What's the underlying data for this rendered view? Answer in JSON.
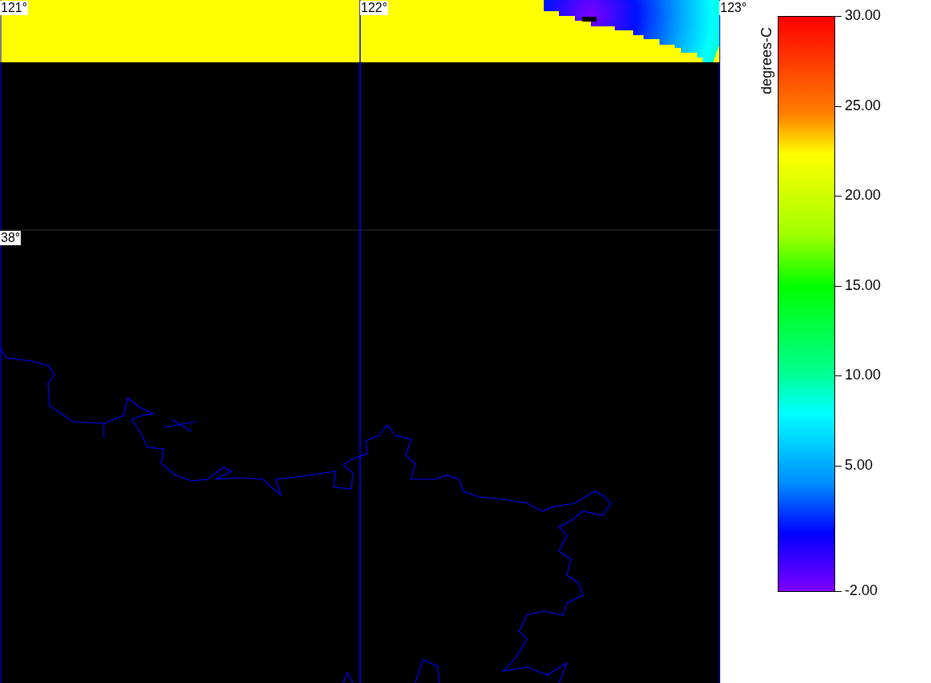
{
  "map": {
    "longitude_labels": [
      "121°",
      "122°",
      "123°"
    ],
    "latitude_labels": [
      "38°"
    ]
  },
  "legend": {
    "unit": "degrees-C",
    "tick_labels": [
      "30.00",
      "25.00",
      "20.00",
      "15.00",
      "10.00",
      "5.00",
      "-2.00"
    ]
  }
}
